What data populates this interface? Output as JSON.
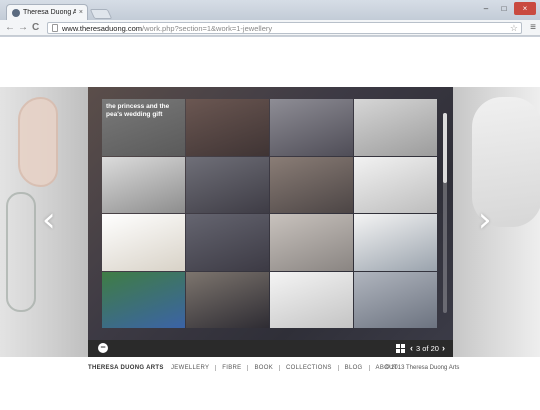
{
  "browser": {
    "tab_title": "Theresa Duong Arts",
    "tab_close": "×",
    "window_buttons": [
      "–",
      "□",
      "×"
    ],
    "nav": {
      "back": "←",
      "forward": "→",
      "reload": "C"
    },
    "url_host": "www.theresaduong.com",
    "url_path": "/work.php?section=1&work=1-jewellery",
    "star": "☆",
    "menu": "≡"
  },
  "gallery": {
    "prev": "‹",
    "next": "›",
    "first_caption": "the princess and the pea's wedding gift",
    "thumbs": [
      {
        "bg": "linear-gradient(160deg,#7a7a7a,#5a5a5a)"
      },
      {
        "bg": "linear-gradient(160deg,#6b5752,#3f3434)"
      },
      {
        "bg": "linear-gradient(160deg,#8e8d95,#4f4d57)"
      },
      {
        "bg": "linear-gradient(160deg,#d6d6d6,#9c9c9c)"
      },
      {
        "bg": "linear-gradient(160deg,#dcdcdc,#8d8d8d)"
      },
      {
        "bg": "linear-gradient(160deg,#6f6f78,#3e3c45)"
      },
      {
        "bg": "linear-gradient(160deg,#8a7d76,#4c4545)"
      },
      {
        "bg": "linear-gradient(160deg,#f2f2f2,#bdbdbd)"
      },
      {
        "bg": "linear-gradient(160deg,#ffffff,#d8d2c7)"
      },
      {
        "bg": "linear-gradient(160deg,#656570,#3c3a44)"
      },
      {
        "bg": "linear-gradient(160deg,#c8c2bd,#8a8582)"
      },
      {
        "bg": "linear-gradient(160deg,#f4f4f4,#9aa3ad)"
      },
      {
        "bg": "linear-gradient(160deg,#3f7d44,#3b63a6)"
      },
      {
        "bg": "linear-gradient(160deg,#7d756e,#2e2c33)"
      },
      {
        "bg": "linear-gradient(160deg,#f4f4f4,#c4c4c4)"
      },
      {
        "bg": "linear-gradient(160deg,#b0b5be,#6c7380)"
      }
    ],
    "minus_icon": "−",
    "counter_text": "3 of 20",
    "prev_small": "‹",
    "next_small": "›"
  },
  "footer": {
    "brand": "THERESA DUONG ARTS",
    "nav": [
      "JEWELLERY",
      "FIBRE",
      "BOOK",
      "COLLECTIONS",
      "BLOG",
      "ABOUT"
    ],
    "copyright": "© 2013 Theresa Duong Arts"
  }
}
